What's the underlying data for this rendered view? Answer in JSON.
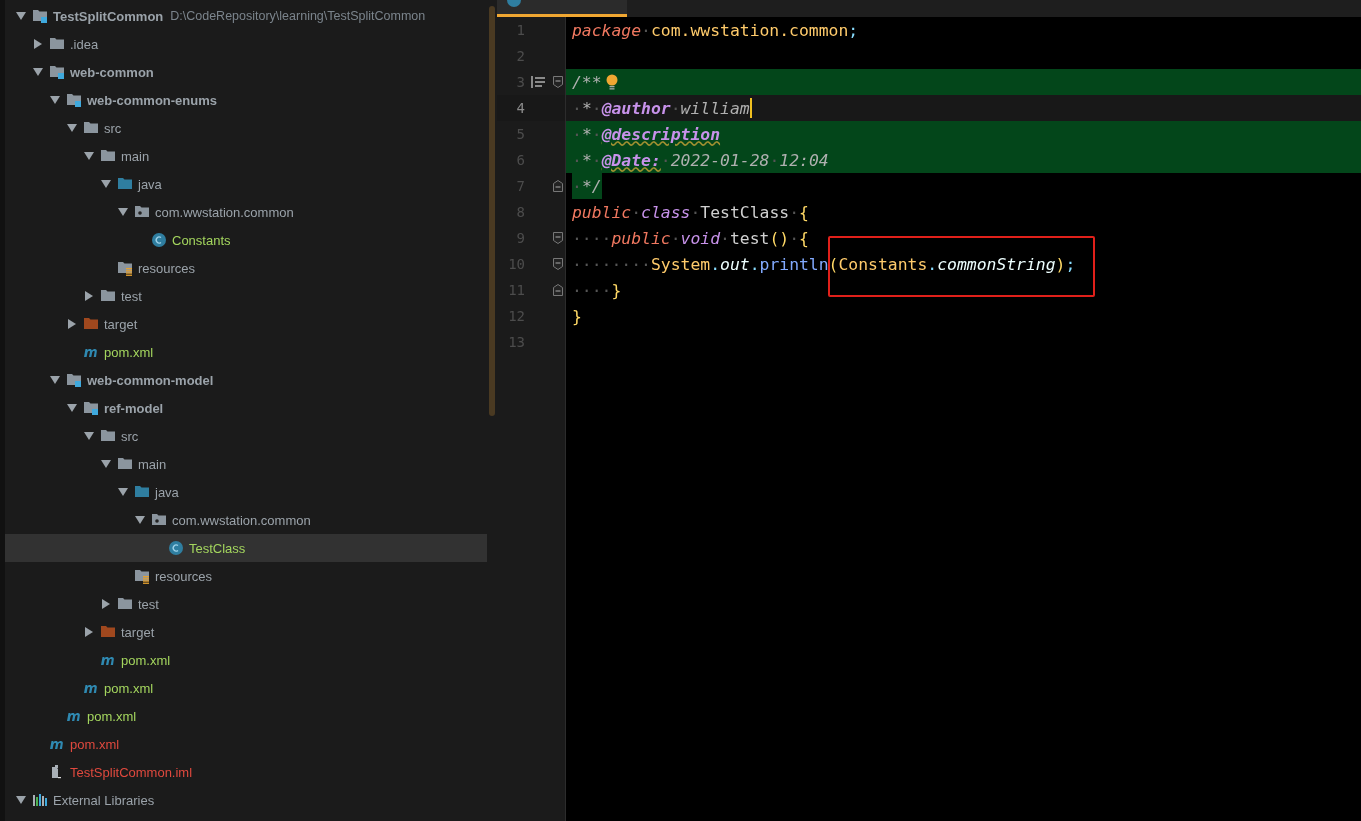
{
  "project_tree": {
    "items": [
      {
        "kind": "module",
        "label": "TestSplitCommon",
        "path": "D:\\CodeRepository\\learning\\TestSplitCommon",
        "color": "#9ba3aa",
        "expanded": true,
        "selected": false,
        "children": [
          {
            "kind": "folder",
            "label": ".idea",
            "color": "#9ba3aa",
            "expanded": false,
            "selected": false
          },
          {
            "kind": "module",
            "label": "web-common",
            "color": "#9ba3aa",
            "expanded": true,
            "selected": false,
            "children": [
              {
                "kind": "module",
                "label": "web-common-enums",
                "color": "#9ba3aa",
                "expanded": true,
                "selected": false,
                "children": [
                  {
                    "kind": "folder",
                    "label": "src",
                    "color": "#9ba3aa",
                    "expanded": true,
                    "selected": false,
                    "children": [
                      {
                        "kind": "folder",
                        "label": "main",
                        "color": "#9ba3aa",
                        "expanded": true,
                        "selected": false,
                        "children": [
                          {
                            "kind": "source",
                            "label": "java",
                            "color": "#9ba3aa",
                            "expanded": true,
                            "selected": false,
                            "children": [
                              {
                                "kind": "package",
                                "label": "com.wwstation.common",
                                "color": "#9ba3aa",
                                "expanded": true,
                                "selected": false,
                                "children": [
                                  {
                                    "kind": "class",
                                    "label": "Constants",
                                    "color": "#a4d65e",
                                    "selected": false
                                  }
                                ]
                              }
                            ]
                          },
                          {
                            "kind": "resources",
                            "label": "resources",
                            "color": "#9ba3aa",
                            "selected": false
                          }
                        ]
                      },
                      {
                        "kind": "folder",
                        "label": "test",
                        "color": "#9ba3aa",
                        "expanded": false,
                        "selected": false
                      }
                    ]
                  },
                  {
                    "kind": "excluded",
                    "label": "target",
                    "color": "#9ba3aa",
                    "expanded": false,
                    "selected": false
                  },
                  {
                    "kind": "maven",
                    "label": "pom.xml",
                    "color": "#a4d65e",
                    "selected": false
                  }
                ]
              },
              {
                "kind": "module",
                "label": "web-common-model",
                "color": "#9ba3aa",
                "expanded": true,
                "selected": false,
                "children": [
                  {
                    "kind": "module",
                    "label": "ref-model",
                    "color": "#9ba3aa",
                    "expanded": true,
                    "selected": false,
                    "children": [
                      {
                        "kind": "folder",
                        "label": "src",
                        "color": "#9ba3aa",
                        "expanded": true,
                        "selected": false,
                        "children": [
                          {
                            "kind": "folder",
                            "label": "main",
                            "color": "#9ba3aa",
                            "expanded": true,
                            "selected": false,
                            "children": [
                              {
                                "kind": "source",
                                "label": "java",
                                "color": "#9ba3aa",
                                "expanded": true,
                                "selected": false,
                                "children": [
                                  {
                                    "kind": "package",
                                    "label": "com.wwstation.common",
                                    "color": "#9ba3aa",
                                    "expanded": true,
                                    "selected": false,
                                    "children": [
                                      {
                                        "kind": "class",
                                        "label": "TestClass",
                                        "color": "#a4d65e",
                                        "selected": true
                                      }
                                    ]
                                  }
                                ]
                              },
                              {
                                "kind": "resources",
                                "label": "resources",
                                "color": "#9ba3aa",
                                "selected": false
                              }
                            ]
                          },
                          {
                            "kind": "folder",
                            "label": "test",
                            "color": "#9ba3aa",
                            "expanded": false,
                            "selected": false
                          }
                        ]
                      },
                      {
                        "kind": "excluded",
                        "label": "target",
                        "color": "#9ba3aa",
                        "expanded": false,
                        "selected": false
                      },
                      {
                        "kind": "maven",
                        "label": "pom.xml",
                        "color": "#a4d65e",
                        "selected": false
                      }
                    ]
                  },
                  {
                    "kind": "maven",
                    "label": "pom.xml",
                    "color": "#a4d65e",
                    "selected": false
                  }
                ]
              },
              {
                "kind": "maven",
                "label": "pom.xml",
                "color": "#a4d65e",
                "selected": false
              }
            ]
          },
          {
            "kind": "maven",
            "label": "pom.xml",
            "color": "#e0493e",
            "selected": false
          },
          {
            "kind": "iml",
            "label": "TestSplitCommon.iml",
            "color": "#e0493e",
            "selected": false
          }
        ]
      },
      {
        "kind": "libraries",
        "label": "External Libraries",
        "color": "#9ba3aa",
        "expanded": true,
        "selected": false
      }
    ]
  },
  "editor": {
    "tabs": [
      {
        "selected": true
      }
    ],
    "lines": [
      {
        "number": "1",
        "kind": "code",
        "current": false,
        "fold_start": false,
        "fold_end": false,
        "tokens": [
          {
            "text": "package",
            "kind": "kw"
          },
          {
            "text": "·",
            "kind": "ws"
          },
          {
            "text": "com.wwstation.common",
            "kind": "pkg"
          },
          {
            "text": ";",
            "kind": "punct"
          }
        ]
      },
      {
        "number": "2",
        "kind": "code",
        "current": false,
        "fold_start": false,
        "fold_end": false
      },
      {
        "number": "3",
        "kind": "doc",
        "current": false,
        "fold_start": true,
        "fold_end": false,
        "reader": true,
        "bulb": true,
        "tokens": [
          {
            "text": "/**",
            "kind": "doc"
          }
        ]
      },
      {
        "number": "4",
        "kind": "code",
        "current": true,
        "fold_start": false,
        "fold_end": false,
        "caret": true,
        "tokens": [
          {
            "text": "·",
            "kind": "ws"
          },
          {
            "text": "*",
            "kind": "doc"
          },
          {
            "text": "·",
            "kind": "ws"
          },
          {
            "text": "@author",
            "kind": "tag"
          },
          {
            "text": "·",
            "kind": "ws"
          },
          {
            "text": "william",
            "kind": "doc"
          }
        ]
      },
      {
        "number": "5",
        "kind": "doc",
        "current": false,
        "fold_start": false,
        "fold_end": false,
        "tokens": [
          {
            "text": "·",
            "kind": "ws"
          },
          {
            "text": "*",
            "kind": "doc"
          },
          {
            "text": "·",
            "kind": "ws"
          },
          {
            "text": "@description",
            "kind": "tag-warn"
          }
        ]
      },
      {
        "number": "6",
        "kind": "doc",
        "current": false,
        "fold_start": false,
        "fold_end": false,
        "tokens": [
          {
            "text": "·",
            "kind": "ws"
          },
          {
            "text": "*",
            "kind": "doc"
          },
          {
            "text": "·",
            "kind": "ws"
          },
          {
            "text": "@Date:",
            "kind": "tag-warn"
          },
          {
            "text": "·",
            "kind": "ws"
          },
          {
            "text": "2022-01-28",
            "kind": "doc"
          },
          {
            "text": "·",
            "kind": "ws"
          },
          {
            "text": "12:04",
            "kind": "doc"
          }
        ]
      },
      {
        "number": "7",
        "kind": "doc-end",
        "current": false,
        "fold_start": false,
        "fold_end": true,
        "tokens": [
          {
            "text": "·",
            "kind": "ws"
          },
          {
            "text": "*/",
            "kind": "doc"
          }
        ]
      },
      {
        "number": "8",
        "kind": "code",
        "current": false,
        "fold_start": false,
        "fold_end": false,
        "tokens": [
          {
            "text": "public",
            "kind": "kw"
          },
          {
            "text": "·",
            "kind": "ws"
          },
          {
            "text": "class",
            "kind": "kw2"
          },
          {
            "text": "·",
            "kind": "ws"
          },
          {
            "text": "TestClass",
            "kind": "plain"
          },
          {
            "text": "·",
            "kind": "ws"
          },
          {
            "text": "{",
            "kind": "brace"
          }
        ]
      },
      {
        "number": "9",
        "kind": "code",
        "current": false,
        "fold_start": true,
        "fold_end": false,
        "tokens": [
          {
            "text": "····",
            "kind": "ws"
          },
          {
            "text": "public",
            "kind": "kw"
          },
          {
            "text": "·",
            "kind": "ws"
          },
          {
            "text": "void",
            "kind": "kw2"
          },
          {
            "text": "·",
            "kind": "ws"
          },
          {
            "text": "test",
            "kind": "plain"
          },
          {
            "text": "()",
            "kind": "brace"
          },
          {
            "text": "·",
            "kind": "ws"
          },
          {
            "text": "{",
            "kind": "brace"
          }
        ]
      },
      {
        "number": "10",
        "kind": "code",
        "current": false,
        "fold_start": true,
        "fold_end": false,
        "tokens": [
          {
            "text": "········",
            "kind": "ws"
          },
          {
            "text": "System",
            "kind": "pkg"
          },
          {
            "text": ".",
            "kind": "punct"
          },
          {
            "text": "out",
            "kind": "field"
          },
          {
            "text": ".",
            "kind": "punct"
          },
          {
            "text": "println",
            "kind": "method"
          },
          {
            "text": "(",
            "kind": "brace"
          },
          {
            "text": "Constants",
            "kind": "pkg"
          },
          {
            "text": ".",
            "kind": "punct"
          },
          {
            "text": "commonString",
            "kind": "field"
          },
          {
            "text": ")",
            "kind": "brace"
          },
          {
            "text": ";",
            "kind": "punct"
          }
        ]
      },
      {
        "number": "11",
        "kind": "code",
        "current": false,
        "fold_start": false,
        "fold_end": true,
        "tokens": [
          {
            "text": "····",
            "kind": "ws"
          },
          {
            "text": "}",
            "kind": "brace"
          }
        ]
      },
      {
        "number": "12",
        "kind": "code",
        "current": false,
        "fold_start": false,
        "fold_end": false,
        "tokens": [
          {
            "text": "}",
            "kind": "brace"
          }
        ]
      },
      {
        "number": "13",
        "kind": "code",
        "current": false,
        "fold_start": false,
        "fold_end": false
      }
    ]
  }
}
